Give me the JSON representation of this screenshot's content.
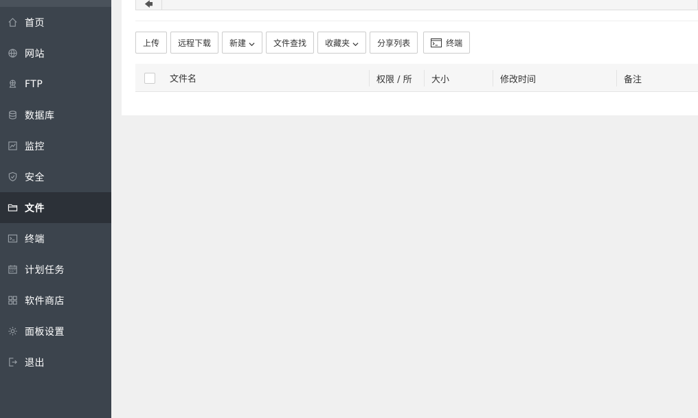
{
  "sidebar": {
    "items": [
      {
        "label": "首页",
        "icon": "home-icon"
      },
      {
        "label": "网站",
        "icon": "globe-icon"
      },
      {
        "label": "FTP",
        "icon": "ftp-icon"
      },
      {
        "label": "数据库",
        "icon": "database-icon"
      },
      {
        "label": "监控",
        "icon": "monitor-icon"
      },
      {
        "label": "安全",
        "icon": "shield-icon"
      },
      {
        "label": "文件",
        "icon": "folder-icon",
        "active": true
      },
      {
        "label": "终端",
        "icon": "terminal-icon"
      },
      {
        "label": "计划任务",
        "icon": "calendar-icon"
      },
      {
        "label": "软件商店",
        "icon": "grid-icon"
      },
      {
        "label": "面板设置",
        "icon": "gear-icon"
      },
      {
        "label": "退出",
        "icon": "logout-icon"
      }
    ]
  },
  "toolbar": {
    "upload": "上传",
    "remote_download": "远程下载",
    "new": "新建",
    "file_search": "文件查找",
    "favorites": "收藏夹",
    "share_list": "分享列表",
    "terminal": "终端"
  },
  "table": {
    "columns": [
      "文件名",
      "权限 / 所",
      "大小",
      "修改时间",
      "备注"
    ]
  },
  "colors": {
    "sidebar_bg": "#3c444d",
    "sidebar_active_bg": "#2c3138",
    "content_bg": "#f0f0f0"
  }
}
